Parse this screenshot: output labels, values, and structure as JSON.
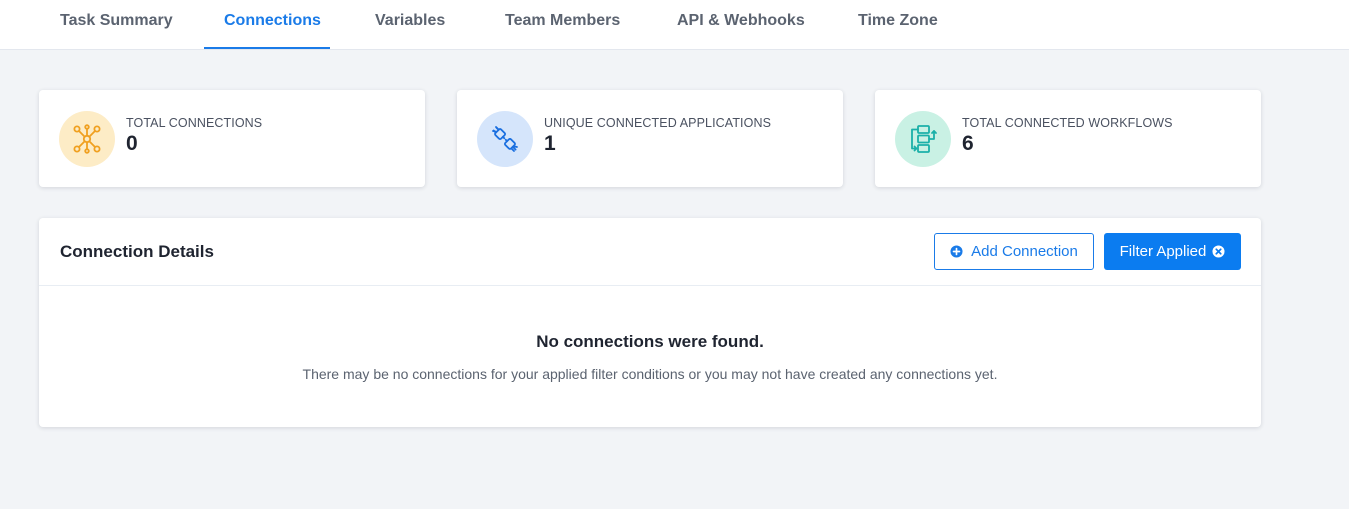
{
  "tabs": [
    {
      "label": "Task Summary",
      "active": false
    },
    {
      "label": "Connections",
      "active": true
    },
    {
      "label": "Variables",
      "active": false
    },
    {
      "label": "Team Members",
      "active": false
    },
    {
      "label": "API & Webhooks",
      "active": false
    },
    {
      "label": "Time Zone",
      "active": false
    }
  ],
  "stats": [
    {
      "label": "TOTAL CONNECTIONS",
      "value": "0",
      "icon": "network-hub-icon",
      "icon_bg": "#fdecc6",
      "icon_color": "#f0a020"
    },
    {
      "label": "UNIQUE CONNECTED APPLICATIONS",
      "value": "1",
      "icon": "plug-connection-icon",
      "icon_bg": "#d5e5fb",
      "icon_color": "#1a6fe0"
    },
    {
      "label": "TOTAL CONNECTED WORKFLOWS",
      "value": "6",
      "icon": "workflow-icon",
      "icon_bg": "#c9f1e4",
      "icon_color": "#1ab0a8"
    }
  ],
  "details": {
    "title": "Connection Details",
    "add_button_label": "Add Connection",
    "filter_button_label": "Filter Applied",
    "empty_title": "No connections were found.",
    "empty_description": "There may be no connections for your applied filter conditions or you may not have created any connections yet."
  },
  "colors": {
    "accent": "#1a7be8",
    "page_bg": "#f2f4f7"
  }
}
